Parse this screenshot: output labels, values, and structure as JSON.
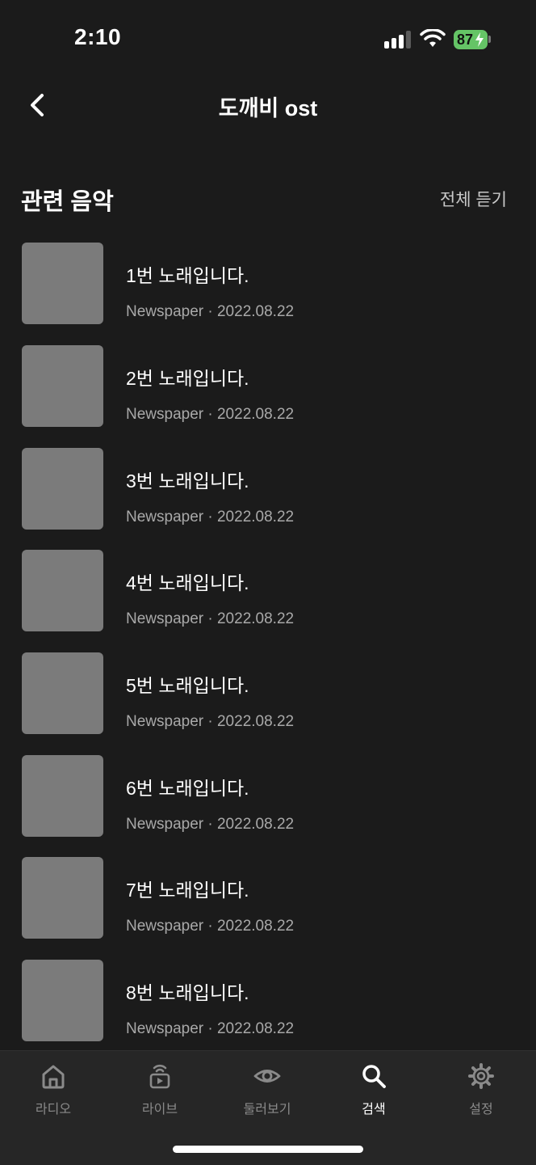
{
  "status_bar": {
    "time": "2:10",
    "battery": "87"
  },
  "header": {
    "title": "도깨비 ost",
    "back_icon": "chevron-left-icon"
  },
  "section": {
    "title": "관련 음악",
    "play_all": "전체 듣기"
  },
  "tracks": [
    {
      "title": "1번 노래입니다.",
      "meta": "Newspaper · 2022.08.22"
    },
    {
      "title": "2번 노래입니다.",
      "meta": "Newspaper · 2022.08.22"
    },
    {
      "title": "3번 노래입니다.",
      "meta": "Newspaper · 2022.08.22"
    },
    {
      "title": "4번 노래입니다.",
      "meta": "Newspaper · 2022.08.22"
    },
    {
      "title": "5번 노래입니다.",
      "meta": "Newspaper · 2022.08.22"
    },
    {
      "title": "6번 노래입니다.",
      "meta": "Newspaper · 2022.08.22"
    },
    {
      "title": "7번 노래입니다.",
      "meta": "Newspaper · 2022.08.22"
    },
    {
      "title": "8번 노래입니다.",
      "meta": "Newspaper · 2022.08.22"
    }
  ],
  "tab_bar": {
    "items": [
      {
        "label": "라디오",
        "icon": "home-icon",
        "active": false
      },
      {
        "label": "라이브",
        "icon": "live-radio-icon",
        "active": false
      },
      {
        "label": "둘러보기",
        "icon": "eye-icon",
        "active": false
      },
      {
        "label": "검색",
        "icon": "search-icon",
        "active": true
      },
      {
        "label": "설정",
        "icon": "gear-icon",
        "active": false
      }
    ]
  },
  "colors": {
    "background": "#1b1b1b",
    "tab_bar": "#262626",
    "thumbnail": "#7b7b7b",
    "battery": "#65c466",
    "inactive": "#8a8a8a"
  }
}
